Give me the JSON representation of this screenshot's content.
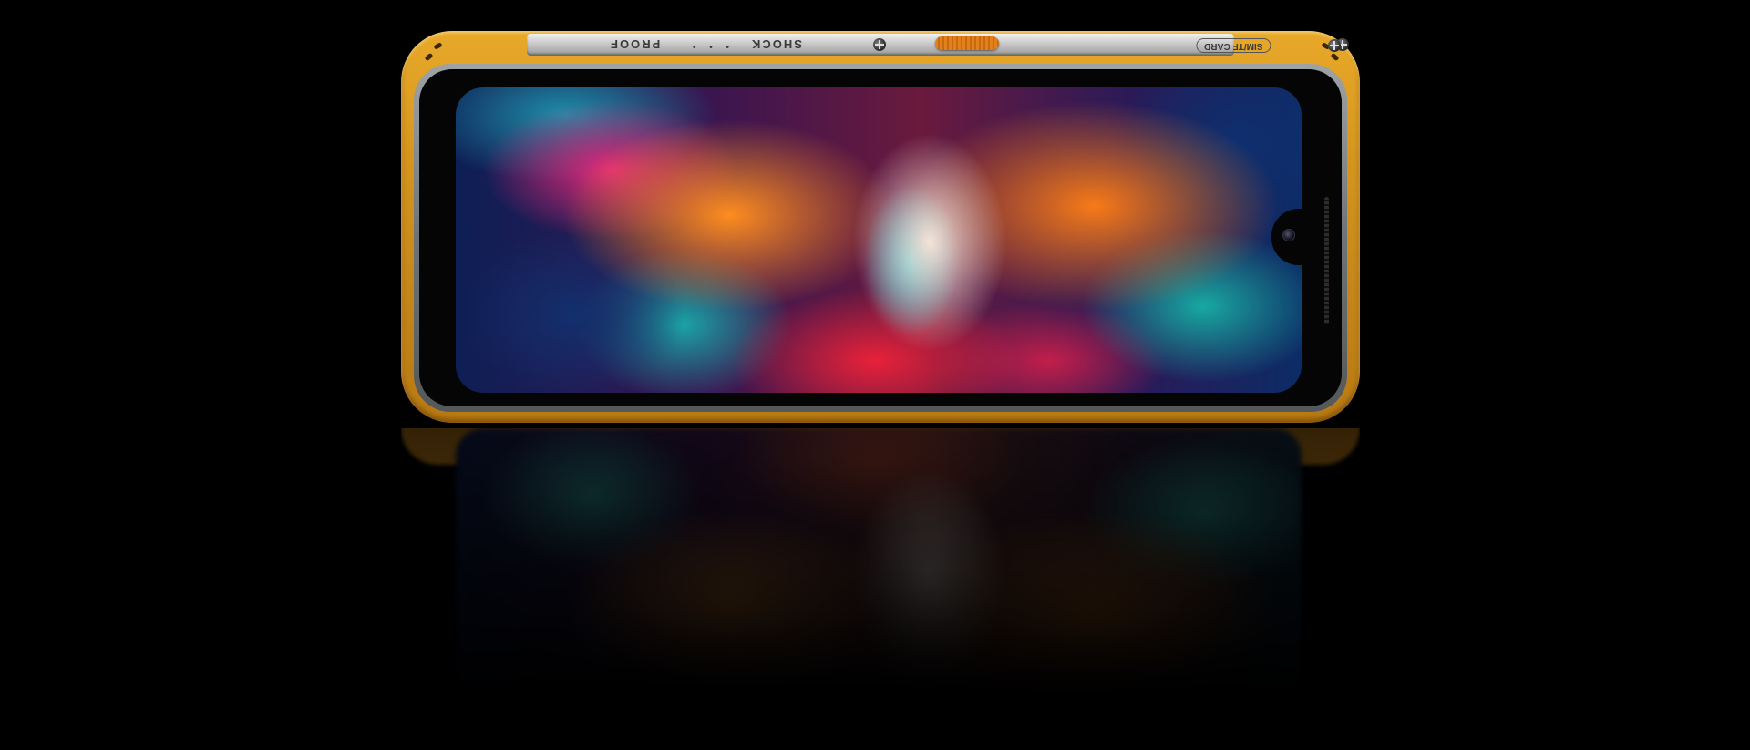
{
  "phone": {
    "rail_text_left": "PROOF",
    "rail_dots": "• • •",
    "rail_text_right": "SHOCK",
    "sim_label": "SIM/TF CARD"
  },
  "colors": {
    "background": "#000000",
    "bumper": "#e0a024",
    "frame": "#7a7f82",
    "button": "#e4801c"
  },
  "icons": [
    "screw-icon",
    "camera-icon",
    "speaker-grille-icon"
  ]
}
